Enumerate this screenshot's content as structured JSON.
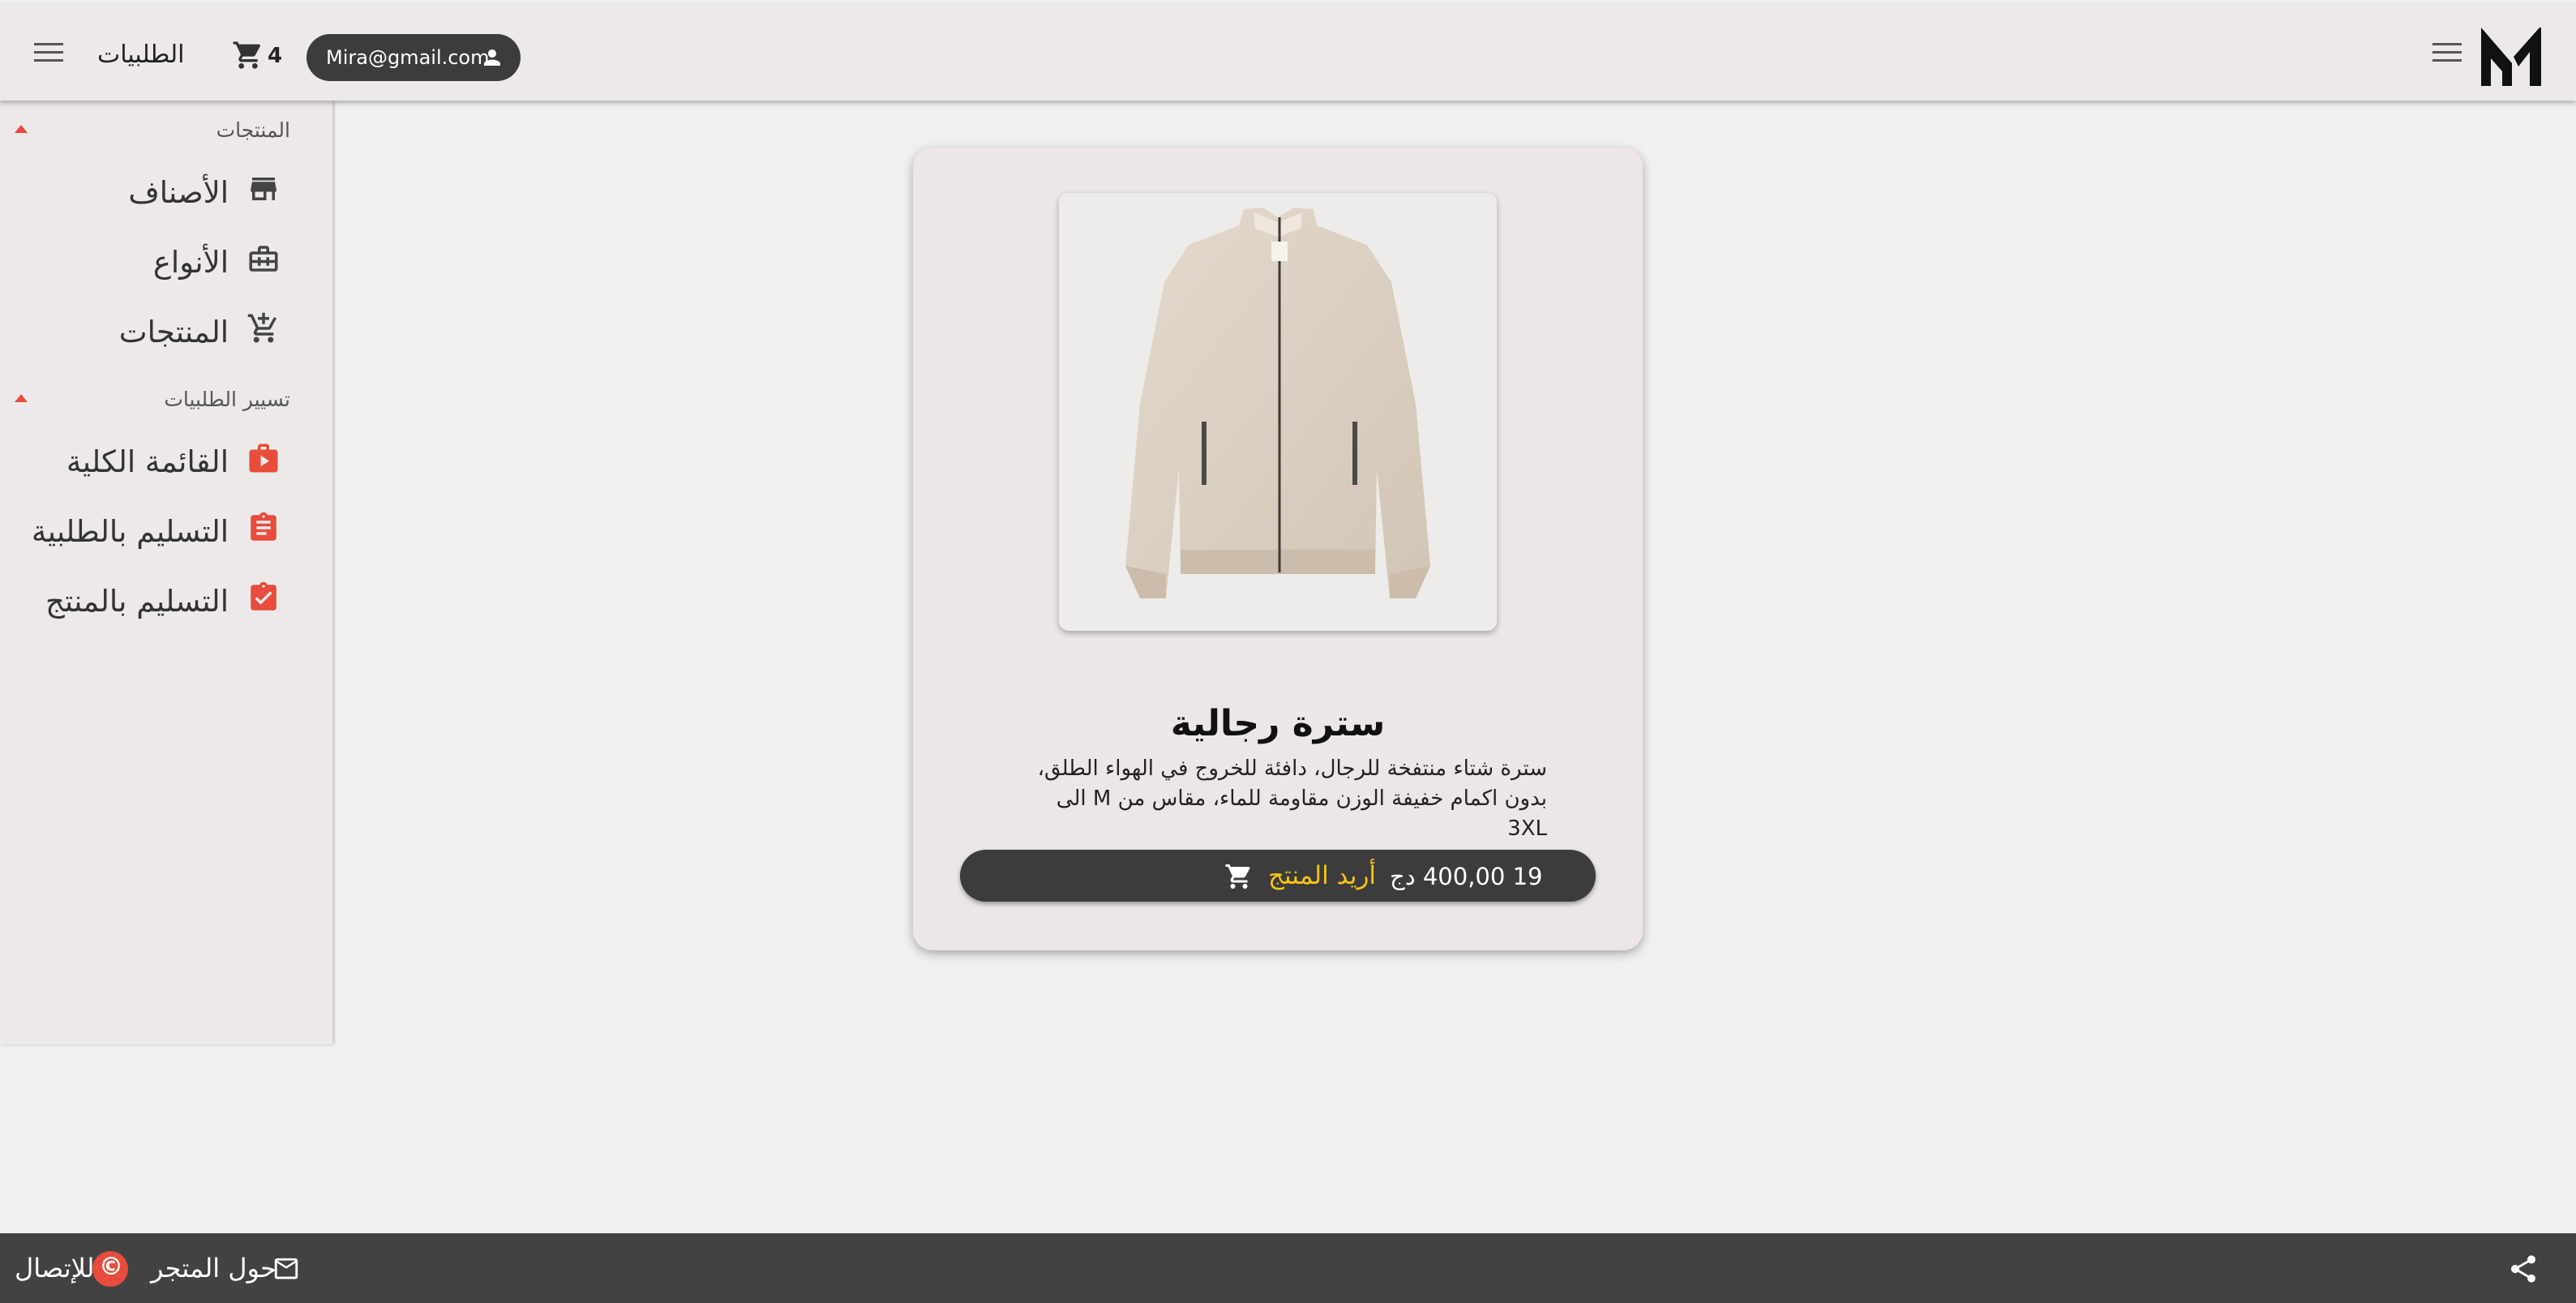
{
  "header": {
    "orders_label": "الطلبيات",
    "cart_count": "4",
    "user_email": "Mira@gmail.com"
  },
  "sidebar": {
    "sections": [
      {
        "title": "المنتجات",
        "items": [
          {
            "label": "الأصناف",
            "icon": "store-icon"
          },
          {
            "label": "الأنواع",
            "icon": "briefcase-icon"
          },
          {
            "label": "المنتجات",
            "icon": "add-cart-icon"
          }
        ]
      },
      {
        "title": "تسيير الطلبيات",
        "items": [
          {
            "label": "القائمة الكلية",
            "icon": "shopping-bag-icon"
          },
          {
            "label": "التسليم بالطلبية",
            "icon": "clipboard-list-icon"
          },
          {
            "label": "التسليم بالمنتج",
            "icon": "clipboard-check-icon"
          }
        ]
      }
    ]
  },
  "product": {
    "title": "سترة رجالية",
    "description": "سترة شتاء منتفخة للرجال، دافئة للخروج في الهواء الطلق، بدون اكمام خفيفة الوزن مقاومة للماء، مقاس من M الى 3XL",
    "price": "19 400,00 دج",
    "buy_label": "أريد المنتج"
  },
  "footer": {
    "contact_label": "للإتصال",
    "about_label": "حول المتجر"
  },
  "colors": {
    "accent": "#e74c3c",
    "buy_text": "#f5c518",
    "dark": "#3c3c3c"
  }
}
